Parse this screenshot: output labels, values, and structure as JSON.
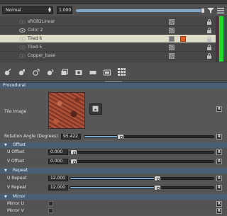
{
  "blend": {
    "mode": "Normal",
    "opacity_value": "1.000",
    "opacity_level": 1.0
  },
  "layers": [
    {
      "name": "sRGB2Linear",
      "visible": false,
      "selected": false,
      "thumb": "pattern",
      "has_fx": false
    },
    {
      "name": "Color 2",
      "visible": true,
      "selected": false,
      "thumb": "pattern",
      "has_fx": false
    },
    {
      "name": "Tiled 6",
      "visible": true,
      "selected": true,
      "thumb": "solid",
      "has_fx": true
    },
    {
      "name": "Tiled 5",
      "visible": false,
      "selected": false,
      "thumb": "pattern",
      "has_fx": false
    },
    {
      "name": "Copper_base",
      "visible": false,
      "selected": false,
      "thumb": "pattern",
      "has_fx": false
    }
  ],
  "toolbar": {
    "tools": [
      "paint-layer-icon",
      "fill-layer-icon",
      "procedural-layer-icon",
      "adjustment-layer-icon",
      "layer-group-icon",
      "add-mask-icon",
      "delete-icon",
      "effects-icon",
      "grid-icon"
    ]
  },
  "procedural": {
    "header": "Procedural",
    "tile_image_label": "Tile Image",
    "rotation_label": "Rotation Angle (Degrees)",
    "rotation_value": "95.422",
    "rotation_level": 0.265,
    "offset_title": "Offset",
    "u_offset_label": "U Offset",
    "u_offset_value": "0.000",
    "u_offset_level": 0.0,
    "v_offset_label": "V Offset",
    "v_offset_value": "0.000",
    "v_offset_level": 0.0,
    "repeat_title": "Repeat",
    "u_repeat_label": "U Repeat",
    "u_repeat_value": "12.000",
    "u_repeat_level": 0.615,
    "v_repeat_label": "V Repeat",
    "v_repeat_value": "12.000",
    "v_repeat_level": 0.615,
    "mirror_title": "Mirror",
    "mirror_u_label": "Mirror U",
    "mirror_v_label": "Mirror V",
    "reset_label": "R"
  },
  "colors": {
    "accent": "#7fa6c6",
    "selected_row": "#dcdcc8",
    "section_header": "#4b5f74",
    "status_green": "#1edc2a"
  }
}
